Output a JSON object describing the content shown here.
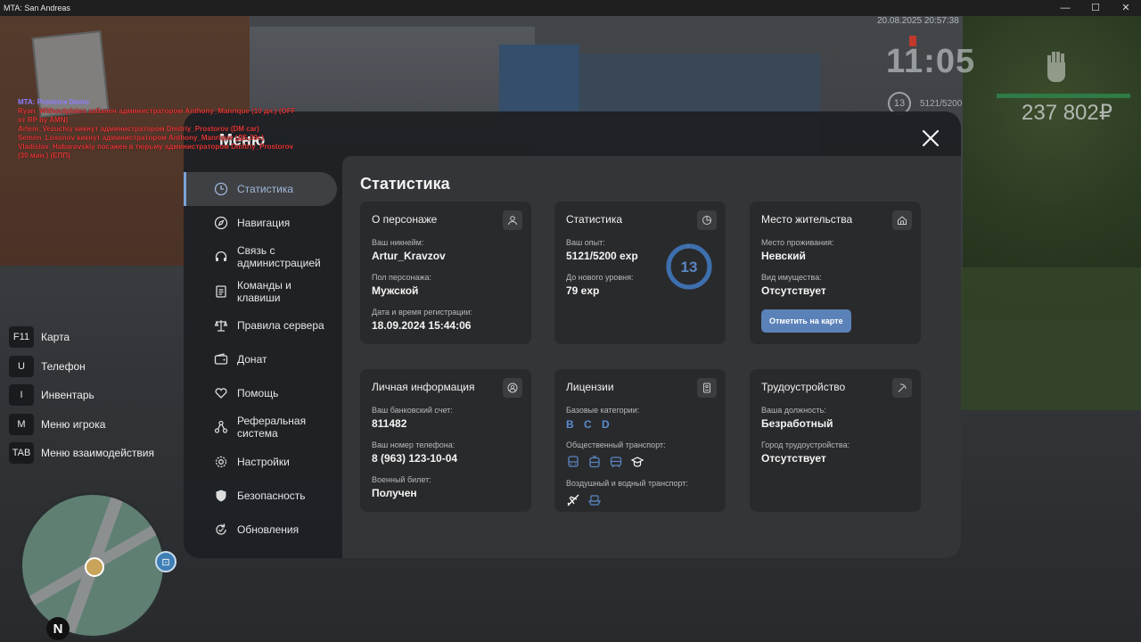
{
  "window": {
    "title": "MTA: San Andreas",
    "controls": [
      "—",
      "☐",
      "✕"
    ]
  },
  "hud": {
    "datetime": "20.08.2025 20:57:38",
    "time": "11:05",
    "level": "13",
    "exp": "5121/5200",
    "money": "237 802₽"
  },
  "chat": {
    "header": "MTA: Province Demo",
    "messages": [
      "Ryan_Withoutplates забанен администратором Anthony_Manrique (10 дн.) (OFF от RP by AMN)",
      "Artem_Vezuchiy кикнут администратором Dmitriy_Prostorov (DM car)",
      "Semen_Loxonov кикнут администратором Anthony_Manrique (ДБ,39с)",
      "Vladislav_Habarovskiy посажен в тюрьму администратором Dmitriy_Prostorov (30 мин.) (ЕПП)"
    ]
  },
  "key_hints": [
    {
      "key": "F11",
      "label": "Карта"
    },
    {
      "key": "U",
      "label": "Телефон"
    },
    {
      "key": "I",
      "label": "Инвентарь"
    },
    {
      "key": "M",
      "label": "Меню игрока"
    },
    {
      "key": "TAB",
      "label": "Меню взаимодействия"
    }
  ],
  "minimap": {
    "north": "N"
  },
  "menu": {
    "title": "Меню",
    "nav": [
      {
        "label": "Статистика",
        "icon": "clock-icon",
        "active": true
      },
      {
        "label": "Навигация",
        "icon": "compass-icon"
      },
      {
        "label": "Связь с администрацией",
        "icon": "headset-icon"
      },
      {
        "label": "Команды и клавиши",
        "icon": "list-icon"
      },
      {
        "label": "Правила сервера",
        "icon": "scales-icon"
      },
      {
        "label": "Донат",
        "icon": "wallet-icon"
      },
      {
        "label": "Помощь",
        "icon": "heart-hand-icon"
      },
      {
        "label": "Реферальная система",
        "icon": "network-icon"
      },
      {
        "label": "Настройки",
        "icon": "gear-icon"
      },
      {
        "label": "Безопасность",
        "icon": "shield-icon"
      },
      {
        "label": "Обновления",
        "icon": "refresh-icon"
      }
    ],
    "content_title": "Статистика",
    "cards": {
      "character": {
        "title": "О персонаже",
        "nickname_label": "Ваш никнейм:",
        "nickname": "Artur_Kravzov",
        "gender_label": "Пол персонажа:",
        "gender": "Мужской",
        "reg_label": "Дата и время регистрации:",
        "reg": "18.09.2024 15:44:06"
      },
      "stats": {
        "title": "Статистика",
        "exp_label": "Ваш опыт:",
        "exp": "5121/5200 exp",
        "next_label": "До нового уровня:",
        "next": "79 exp",
        "level": "13",
        "progress": 0.985
      },
      "residence": {
        "title": "Место жительства",
        "place_label": "Место проживания:",
        "place": "Невский",
        "property_label": "Вид имущества:",
        "property": "Отсутствует",
        "button": "Отметить на карте"
      },
      "personal": {
        "title": "Личная информация",
        "bank_label": "Ваш банковский счет:",
        "bank": "811482",
        "phone_label": "Ваш номер телефона:",
        "phone": "8 (963) 123-10-04",
        "military_label": "Военный билет:",
        "military": "Получен"
      },
      "licenses": {
        "title": "Лицензии",
        "base_label": "Базовые категории:",
        "base": "B C D",
        "public_label": "Общественный транспорт:",
        "air_label": "Воздушный и водный транспорт:"
      },
      "job": {
        "title": "Трудоустройство",
        "position_label": "Ваша должность:",
        "position": "Безработный",
        "city_label": "Город трудоустройства:",
        "city": "Отсутствует"
      }
    }
  }
}
